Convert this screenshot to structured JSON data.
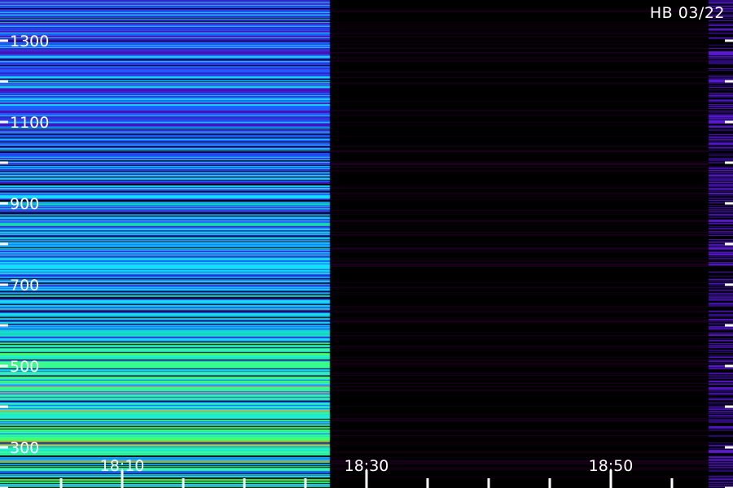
{
  "chart_data": {
    "type": "heatmap",
    "title": "",
    "stamp": "HB 03/22",
    "y_axis": {
      "side": "left",
      "range": [
        200,
        1400
      ],
      "tick_labels": [
        {
          "value": 1300,
          "label": "1300"
        },
        {
          "value": 1100,
          "label": "1100"
        },
        {
          "value": 900,
          "label": "900"
        },
        {
          "value": 700,
          "label": "700"
        },
        {
          "value": 500,
          "label": "500"
        },
        {
          "value": 300,
          "label": "300"
        }
      ],
      "tick_values": [
        1300,
        1200,
        1100,
        1000,
        900,
        800,
        700,
        600,
        500,
        400,
        300,
        200
      ]
    },
    "x_axis": {
      "side": "bottom",
      "range": [
        "18:00",
        "19:00"
      ],
      "tick_labels": [
        {
          "value": "18:10",
          "label": "18:10"
        },
        {
          "value": "18:30",
          "label": "18:30"
        },
        {
          "value": "18:50",
          "label": "18:50"
        }
      ],
      "tick_values": [
        "18:05",
        "18:10",
        "18:15",
        "18:20",
        "18:25",
        "18:30",
        "18:35",
        "18:40",
        "18:45",
        "18:50",
        "18:55"
      ]
    },
    "active_interval": {
      "start": "18:00",
      "end": "18:27"
    },
    "quiet_interval": {
      "start": "18:27",
      "end": "18:58"
    },
    "edge_interval": {
      "start": "18:58",
      "end": "19:00"
    },
    "colors": {
      "background": "#000000",
      "low_intensity": "#4b0fb4",
      "medium_intensity": "#1e5cff",
      "high_intensity": "#12e0ff",
      "peak_intensity": "#4dff5a",
      "quiet_band": "#120012",
      "labels": "#ffffff"
    }
  }
}
